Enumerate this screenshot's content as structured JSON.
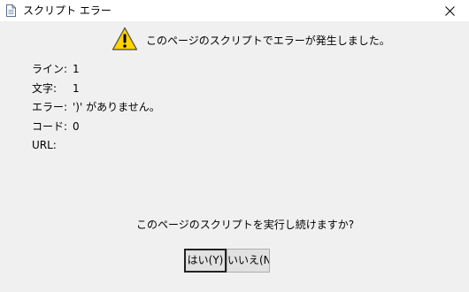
{
  "window": {
    "title": "スクリプト エラー",
    "close_icon": "close-icon",
    "app_icon": "document-icon"
  },
  "message": {
    "icon": "warning-icon",
    "text": "このページのスクリプトでエラーが発生しました。"
  },
  "details": [
    {
      "label": "ライン:",
      "value": "1"
    },
    {
      "label": "文字:",
      "value": "1"
    },
    {
      "label": "エラー:",
      "value": "')' がありません。"
    },
    {
      "label": "コード:",
      "value": "0"
    },
    {
      "label": "URL:",
      "value": ""
    }
  ],
  "question": "このページのスクリプトを実行し続けますか?",
  "buttons": {
    "yes": "はい(Y)",
    "no": "いいえ(N"
  },
  "colors": {
    "background": "#f0f0f0",
    "titlebar": "#ffffff",
    "warning_fill": "#ffd200",
    "button_face": "#e1e1e1"
  }
}
